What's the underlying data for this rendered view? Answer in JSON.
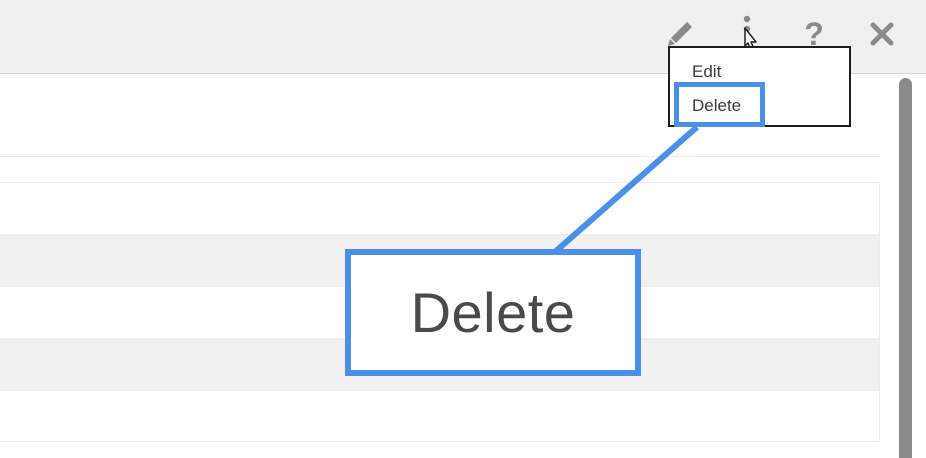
{
  "toolbar": {
    "icons": [
      "pencil-icon",
      "vertical-dots-icon",
      "help-icon",
      "close-icon"
    ],
    "help_glyph": "?",
    "close_glyph": "✕"
  },
  "menu": {
    "items": [
      {
        "label": "Edit"
      },
      {
        "label": "Delete"
      }
    ]
  },
  "callout": {
    "text": "Delete"
  },
  "colors": {
    "accent": "#4a8fe8",
    "topbar": "#f0f0f0",
    "icon": "#8a8a8a",
    "row_alt": "#f0f0f0"
  }
}
